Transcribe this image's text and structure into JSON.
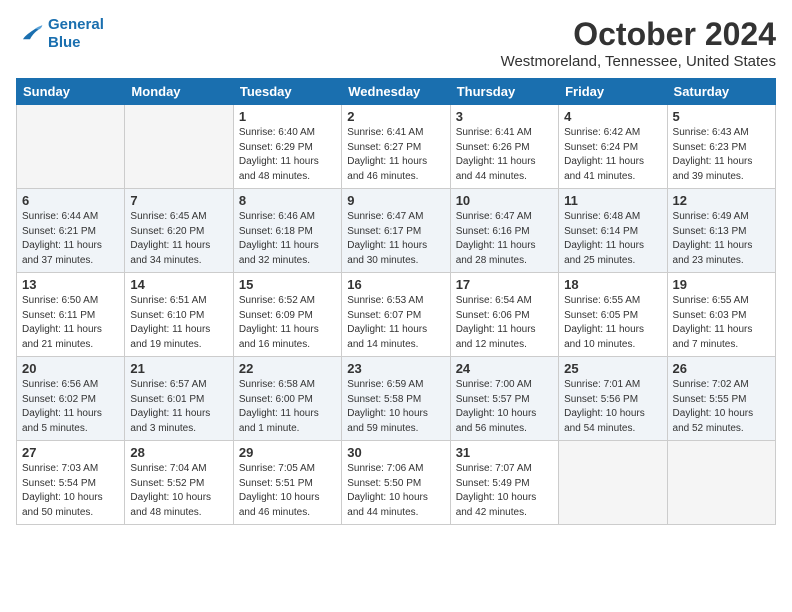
{
  "logo": {
    "line1": "General",
    "line2": "Blue"
  },
  "title": "October 2024",
  "location": "Westmoreland, Tennessee, United States",
  "headers": [
    "Sunday",
    "Monday",
    "Tuesday",
    "Wednesday",
    "Thursday",
    "Friday",
    "Saturday"
  ],
  "weeks": [
    [
      {
        "day": "",
        "info": ""
      },
      {
        "day": "",
        "info": ""
      },
      {
        "day": "1",
        "info": "Sunrise: 6:40 AM\nSunset: 6:29 PM\nDaylight: 11 hours and 48 minutes."
      },
      {
        "day": "2",
        "info": "Sunrise: 6:41 AM\nSunset: 6:27 PM\nDaylight: 11 hours and 46 minutes."
      },
      {
        "day": "3",
        "info": "Sunrise: 6:41 AM\nSunset: 6:26 PM\nDaylight: 11 hours and 44 minutes."
      },
      {
        "day": "4",
        "info": "Sunrise: 6:42 AM\nSunset: 6:24 PM\nDaylight: 11 hours and 41 minutes."
      },
      {
        "day": "5",
        "info": "Sunrise: 6:43 AM\nSunset: 6:23 PM\nDaylight: 11 hours and 39 minutes."
      }
    ],
    [
      {
        "day": "6",
        "info": "Sunrise: 6:44 AM\nSunset: 6:21 PM\nDaylight: 11 hours and 37 minutes."
      },
      {
        "day": "7",
        "info": "Sunrise: 6:45 AM\nSunset: 6:20 PM\nDaylight: 11 hours and 34 minutes."
      },
      {
        "day": "8",
        "info": "Sunrise: 6:46 AM\nSunset: 6:18 PM\nDaylight: 11 hours and 32 minutes."
      },
      {
        "day": "9",
        "info": "Sunrise: 6:47 AM\nSunset: 6:17 PM\nDaylight: 11 hours and 30 minutes."
      },
      {
        "day": "10",
        "info": "Sunrise: 6:47 AM\nSunset: 6:16 PM\nDaylight: 11 hours and 28 minutes."
      },
      {
        "day": "11",
        "info": "Sunrise: 6:48 AM\nSunset: 6:14 PM\nDaylight: 11 hours and 25 minutes."
      },
      {
        "day": "12",
        "info": "Sunrise: 6:49 AM\nSunset: 6:13 PM\nDaylight: 11 hours and 23 minutes."
      }
    ],
    [
      {
        "day": "13",
        "info": "Sunrise: 6:50 AM\nSunset: 6:11 PM\nDaylight: 11 hours and 21 minutes."
      },
      {
        "day": "14",
        "info": "Sunrise: 6:51 AM\nSunset: 6:10 PM\nDaylight: 11 hours and 19 minutes."
      },
      {
        "day": "15",
        "info": "Sunrise: 6:52 AM\nSunset: 6:09 PM\nDaylight: 11 hours and 16 minutes."
      },
      {
        "day": "16",
        "info": "Sunrise: 6:53 AM\nSunset: 6:07 PM\nDaylight: 11 hours and 14 minutes."
      },
      {
        "day": "17",
        "info": "Sunrise: 6:54 AM\nSunset: 6:06 PM\nDaylight: 11 hours and 12 minutes."
      },
      {
        "day": "18",
        "info": "Sunrise: 6:55 AM\nSunset: 6:05 PM\nDaylight: 11 hours and 10 minutes."
      },
      {
        "day": "19",
        "info": "Sunrise: 6:55 AM\nSunset: 6:03 PM\nDaylight: 11 hours and 7 minutes."
      }
    ],
    [
      {
        "day": "20",
        "info": "Sunrise: 6:56 AM\nSunset: 6:02 PM\nDaylight: 11 hours and 5 minutes."
      },
      {
        "day": "21",
        "info": "Sunrise: 6:57 AM\nSunset: 6:01 PM\nDaylight: 11 hours and 3 minutes."
      },
      {
        "day": "22",
        "info": "Sunrise: 6:58 AM\nSunset: 6:00 PM\nDaylight: 11 hours and 1 minute."
      },
      {
        "day": "23",
        "info": "Sunrise: 6:59 AM\nSunset: 5:58 PM\nDaylight: 10 hours and 59 minutes."
      },
      {
        "day": "24",
        "info": "Sunrise: 7:00 AM\nSunset: 5:57 PM\nDaylight: 10 hours and 56 minutes."
      },
      {
        "day": "25",
        "info": "Sunrise: 7:01 AM\nSunset: 5:56 PM\nDaylight: 10 hours and 54 minutes."
      },
      {
        "day": "26",
        "info": "Sunrise: 7:02 AM\nSunset: 5:55 PM\nDaylight: 10 hours and 52 minutes."
      }
    ],
    [
      {
        "day": "27",
        "info": "Sunrise: 7:03 AM\nSunset: 5:54 PM\nDaylight: 10 hours and 50 minutes."
      },
      {
        "day": "28",
        "info": "Sunrise: 7:04 AM\nSunset: 5:52 PM\nDaylight: 10 hours and 48 minutes."
      },
      {
        "day": "29",
        "info": "Sunrise: 7:05 AM\nSunset: 5:51 PM\nDaylight: 10 hours and 46 minutes."
      },
      {
        "day": "30",
        "info": "Sunrise: 7:06 AM\nSunset: 5:50 PM\nDaylight: 10 hours and 44 minutes."
      },
      {
        "day": "31",
        "info": "Sunrise: 7:07 AM\nSunset: 5:49 PM\nDaylight: 10 hours and 42 minutes."
      },
      {
        "day": "",
        "info": ""
      },
      {
        "day": "",
        "info": ""
      }
    ]
  ]
}
